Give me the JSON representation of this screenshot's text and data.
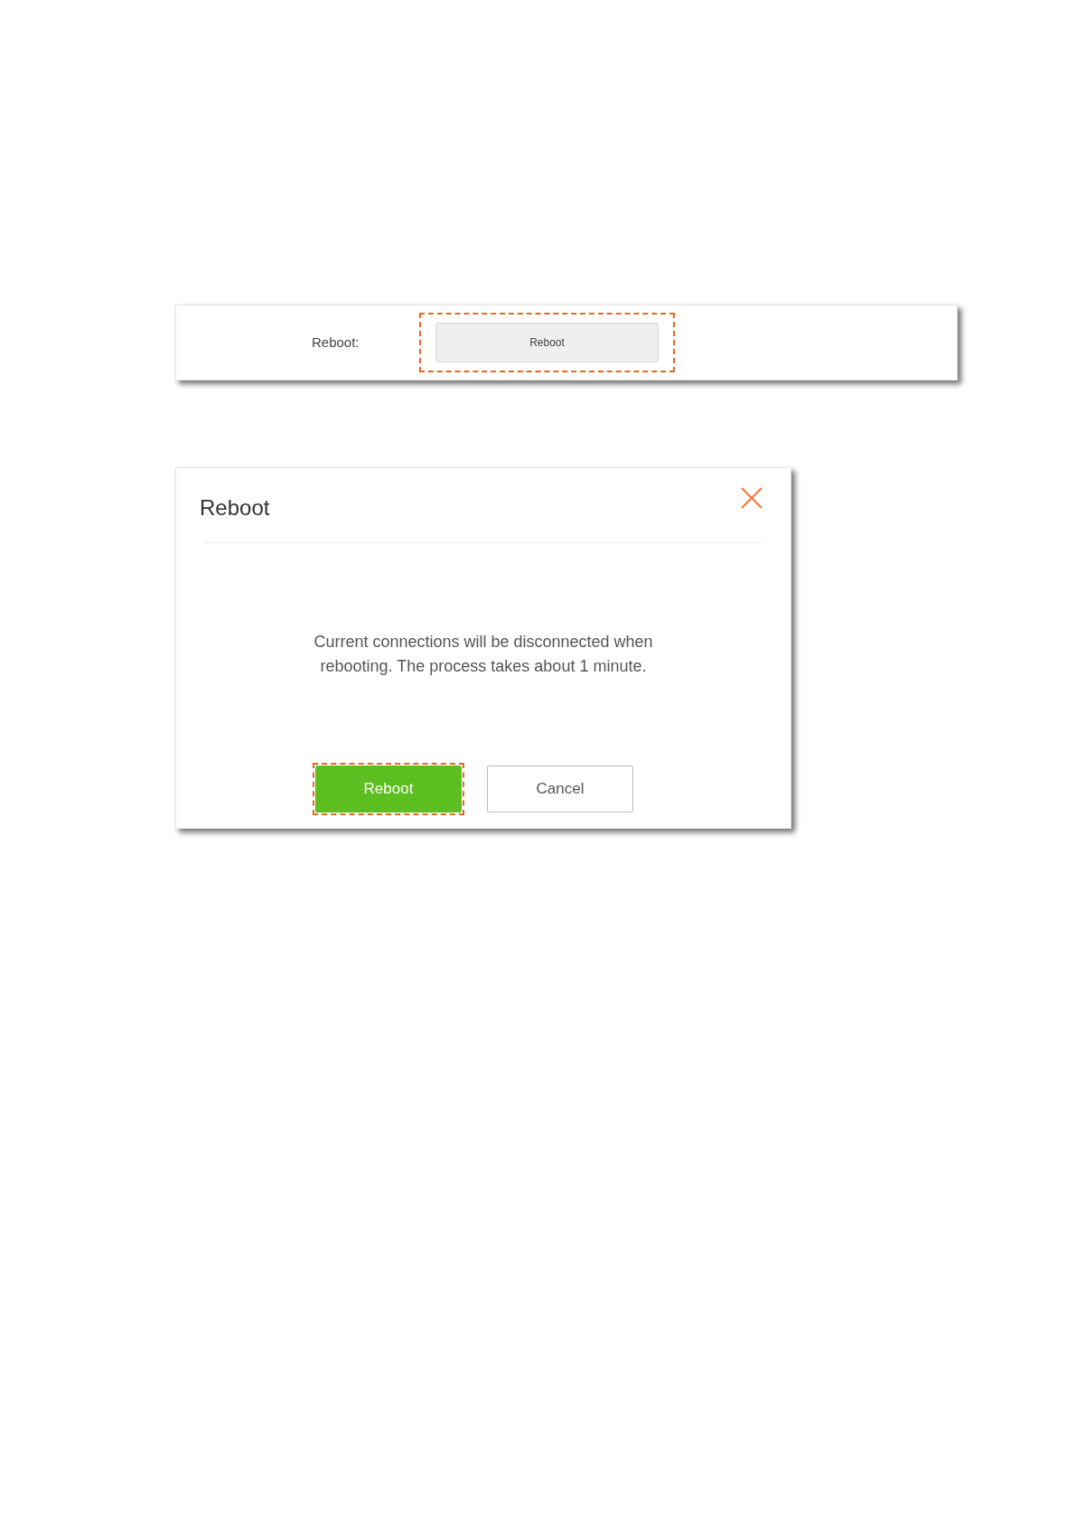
{
  "settings_panel": {
    "label": "Reboot:",
    "button": {
      "label": "Reboot",
      "highlighted": true
    }
  },
  "dialog": {
    "title": "Reboot",
    "message": "Current connections will be disconnected when rebooting. The process takes about 1 minute.",
    "buttons": [
      {
        "label": "Reboot",
        "kind": "primary",
        "highlighted": true
      },
      {
        "label": "Cancel",
        "kind": "secondary",
        "highlighted": false
      }
    ]
  }
}
